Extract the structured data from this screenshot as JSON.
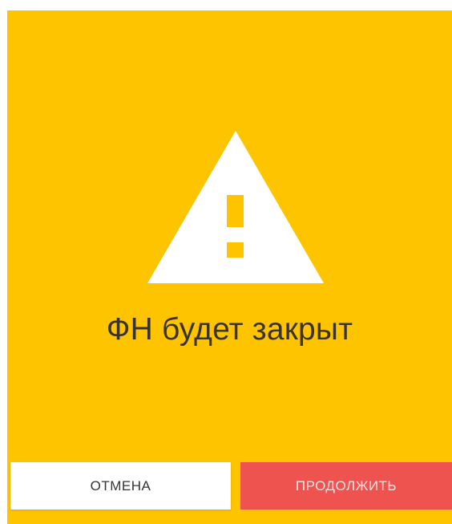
{
  "dialog": {
    "title": "ФН будет закрыт",
    "icon": "warning-icon",
    "background_color": "#FFC400",
    "buttons": {
      "cancel_label": "ОТМЕНА",
      "continue_label": "ПРОДОЛЖИТЬ"
    },
    "colors": {
      "cancel_bg": "#FFFFFF",
      "continue_bg": "#EF5350"
    }
  }
}
